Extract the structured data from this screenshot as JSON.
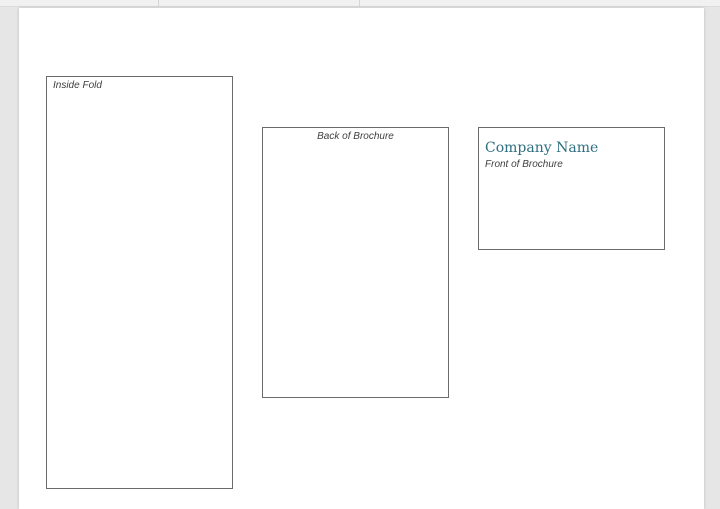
{
  "document": {
    "inside_fold_label": "Inside Fold",
    "back_label": "Back of Brochure",
    "front": {
      "company_name": "Company Name",
      "label": "Front of Brochure"
    }
  },
  "colors": {
    "company_name": "#2e6f80",
    "frame_border": "#6b6b6b",
    "workspace_bg": "#e6e6e6"
  }
}
